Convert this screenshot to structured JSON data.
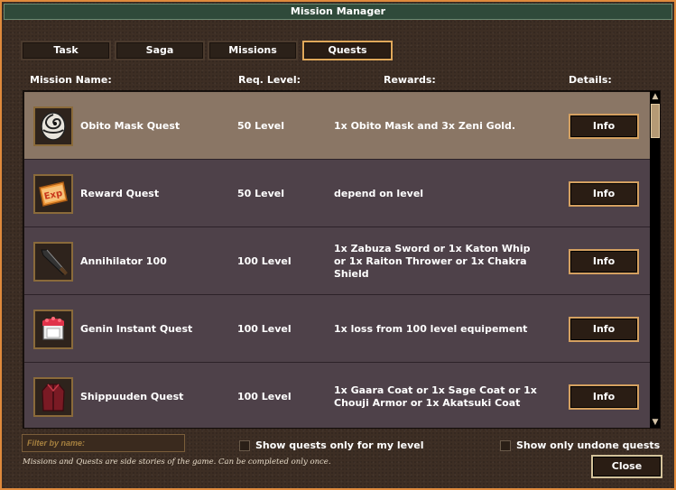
{
  "window": {
    "title": "Mission Manager"
  },
  "tabs": [
    {
      "label": "Task"
    },
    {
      "label": "Saga"
    },
    {
      "label": "Missions"
    },
    {
      "label": "Quests",
      "active": true
    }
  ],
  "columns": {
    "name": "Mission Name:",
    "level": "Req. Level:",
    "rewards": "Rewards:",
    "details": "Details:"
  },
  "rows": [
    {
      "icon": "mask-icon",
      "name": "Obito Mask Quest",
      "level": "50 Level",
      "reward": "1x Obito Mask and 3x Zeni Gold.",
      "button": "Info",
      "selected": true
    },
    {
      "icon": "exp-scroll-icon",
      "name": "Reward Quest",
      "level": "50 Level",
      "reward": "depend on level",
      "button": "Info"
    },
    {
      "icon": "sword-icon",
      "name": "Annihilator 100",
      "level": "100 Level",
      "reward": "1x Zabuza Sword or 1x Katon Whip or 1x Raiton Thrower or 1x Chakra Shield",
      "button": "Info"
    },
    {
      "icon": "armor-icon",
      "name": "Genin Instant Quest",
      "level": "100 Level",
      "reward": "1x loss from 100 level equipement",
      "button": "Info"
    },
    {
      "icon": "coat-icon",
      "name": "Shippuuden Quest",
      "level": "100 Level",
      "reward": "1x Gaara Coat or 1x Sage Coat or 1x Chouji Armor or 1x Akatsuki Coat",
      "button": "Info"
    }
  ],
  "filter": {
    "placeholder": "Filter by name:",
    "value": ""
  },
  "checkboxes": {
    "my_level": {
      "label": "Show quests only for my level",
      "checked": false
    },
    "undone": {
      "label": "Show only undone quests",
      "checked": false
    }
  },
  "footnote": "Missions and Quests are side stories of the game. Can be completed only once.",
  "close_label": "Close",
  "colors": {
    "accent": "#e08a3c",
    "selected_row": "#8a7665",
    "row": "#4e4149",
    "button_border": "#d4a060"
  }
}
